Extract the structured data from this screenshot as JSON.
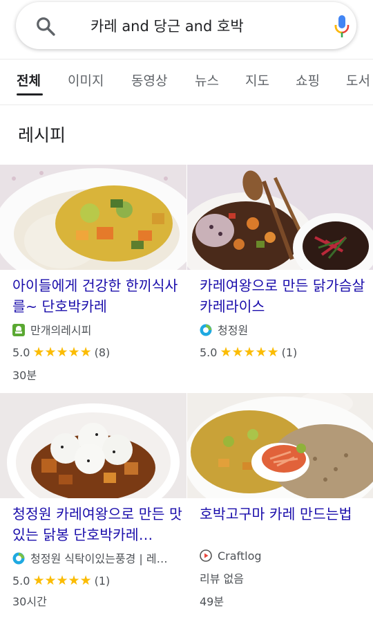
{
  "search": {
    "query": "카레 and 당근 and 호박",
    "search_icon": "search-icon",
    "mic_icon": "mic-icon"
  },
  "tabs": [
    {
      "label": "전체",
      "active": true
    },
    {
      "label": "이미지"
    },
    {
      "label": "동영상"
    },
    {
      "label": "뉴스"
    },
    {
      "label": "지도"
    },
    {
      "label": "쇼핑"
    },
    {
      "label": "도서"
    }
  ],
  "section_title": "레시피",
  "cards": [
    {
      "title": "아이들에게 건강한 한끼식사를~ 단호박카레",
      "source": "만개의레시피",
      "source_icon": "recipe-site-icon",
      "rating": "5.0",
      "stars": "★★★★★",
      "reviews": "(8)",
      "time": "30분"
    },
    {
      "title": "카레여왕으로 만든 닭가슴살 카레라이스",
      "source": "청정원",
      "source_icon": "brand-circle-icon",
      "rating": "5.0",
      "stars": "★★★★★",
      "reviews": "(1)",
      "time": ""
    },
    {
      "title": "청정원 카레여왕으로 만든 맛있는 닭봉 단호박카레…",
      "source": "청정원 식탁이있는풍경 | 레…",
      "source_icon": "brand-circle-icon",
      "rating": "5.0",
      "stars": "★★★★★",
      "reviews": "(1)",
      "time": "30시간"
    },
    {
      "title": "호박고구마 카레 만드는법",
      "source": "Craftlog",
      "source_icon": "play-circle-icon",
      "rating_text": "리뷰 없음",
      "time": "49분"
    }
  ],
  "colors": {
    "link": "#1a0dab",
    "star": "#fbbc04",
    "text_secondary": "#4d5156"
  }
}
